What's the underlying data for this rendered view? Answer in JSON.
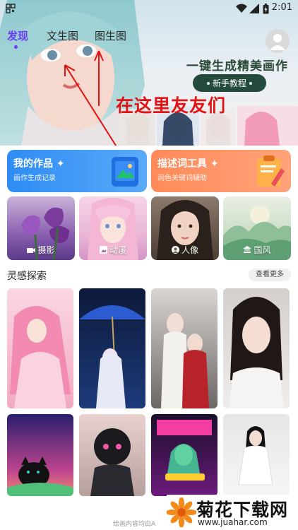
{
  "status_bar": {
    "time": "2:01"
  },
  "tabs": [
    {
      "label": "发现"
    },
    {
      "label": "文生图"
    },
    {
      "label": "图生图"
    }
  ],
  "banner": {
    "slogan": "一键生成精美画作",
    "tutorial_label": "新手教程"
  },
  "annotation": {
    "text": "在这里友友们"
  },
  "cards": [
    {
      "title": "我的作品",
      "subtitle": "画作生成记录"
    },
    {
      "title": "描述词工具",
      "subtitle": "润色关键词辅助"
    }
  ],
  "categories": [
    {
      "label": "摄影",
      "icon": "camera-icon"
    },
    {
      "label": "动漫",
      "icon": "image-icon"
    },
    {
      "label": "人像",
      "icon": "portrait-icon"
    },
    {
      "label": "国风",
      "icon": "pavilion-icon"
    }
  ],
  "inspiration": {
    "title": "灵感探索",
    "more_label": "查看更多"
  },
  "footer_note": "绘画内容均由A",
  "watermark": {
    "text": "菊花下载网",
    "url": "www.juahar.com"
  },
  "colors": {
    "accent": "#6b3df2",
    "annotation": "#e01414",
    "tutorial_bg": "#234a3d"
  }
}
